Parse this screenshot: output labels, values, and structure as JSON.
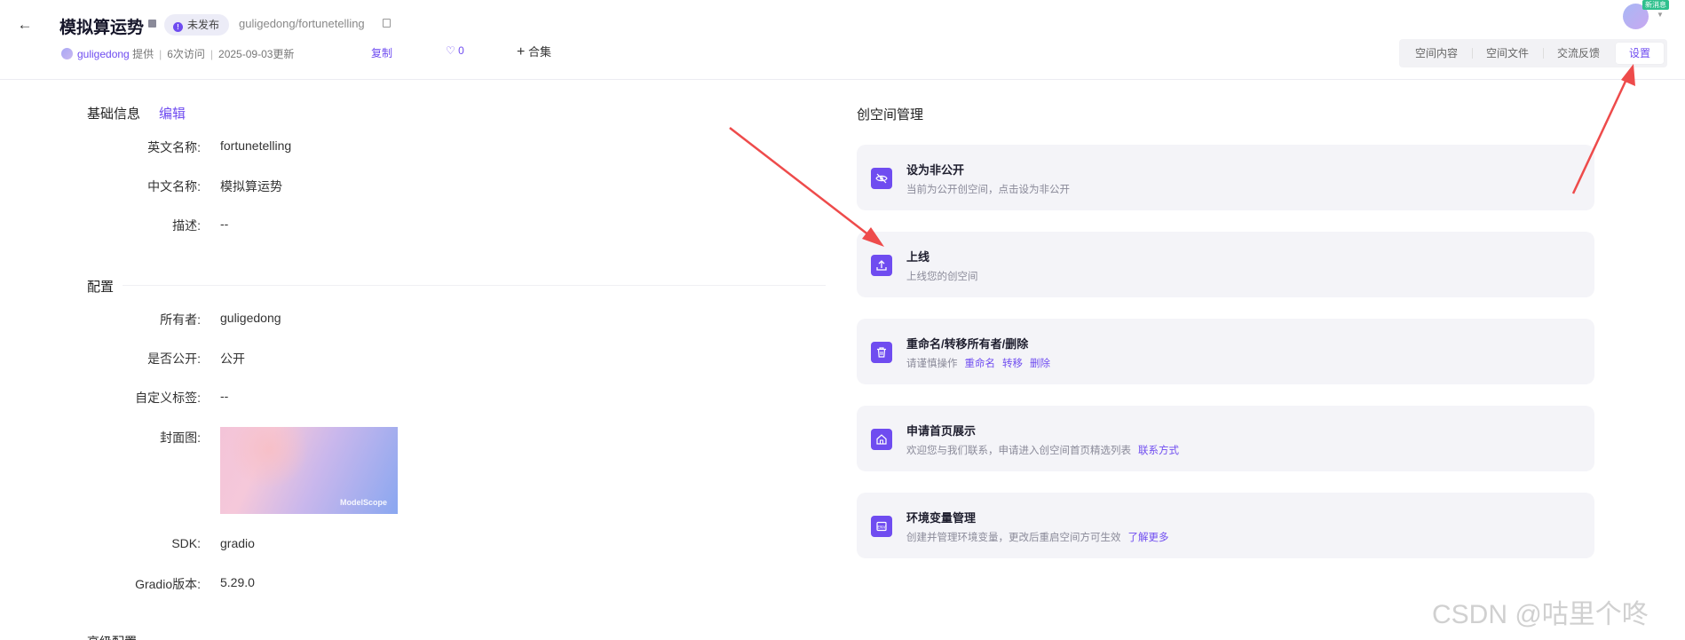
{
  "header": {
    "title": "模拟算运势",
    "status_badge": "未发布",
    "path": "guligedong/fortunetelling",
    "owner": "guligedong",
    "provided": "提供",
    "visits": "6次访问",
    "updated": "2025-09-03更新",
    "copy_label": "复制",
    "likes": "0",
    "collect_label": "合集",
    "tabs": [
      "空间内容",
      "空间文件",
      "交流反馈",
      "设置"
    ],
    "active_tab": "设置",
    "new_message_badge": "新消息"
  },
  "basic": {
    "title": "基础信息",
    "edit_label": "编辑",
    "fields": [
      {
        "label": "英文名称:",
        "value": "fortunetelling"
      },
      {
        "label": "中文名称:",
        "value": "模拟算运势"
      },
      {
        "label": "描述:",
        "value": "--"
      }
    ]
  },
  "config": {
    "title": "配置",
    "fields": [
      {
        "label": "所有者:",
        "value": "guligedong"
      },
      {
        "label": "是否公开:",
        "value": "公开"
      },
      {
        "label": "自定义标签:",
        "value": "--"
      },
      {
        "label": "封面图:",
        "value": ""
      },
      {
        "label": "SDK:",
        "value": "gradio"
      },
      {
        "label": "Gradio版本:",
        "value": "5.29.0"
      }
    ],
    "cover_watermark": "ModelScope"
  },
  "next_section_partial": "高级配置",
  "management": {
    "title": "创空间管理",
    "cards": [
      {
        "title": "设为非公开",
        "desc": "当前为公开创空间，点击设为非公开",
        "icon": "eye-off-icon",
        "links": []
      },
      {
        "title": "上线",
        "desc": "上线您的创空间",
        "icon": "upload-icon",
        "links": []
      },
      {
        "title": "重命名/转移所有者/删除",
        "desc": "请谨慎操作",
        "icon": "trash-icon",
        "links": [
          "重命名",
          "转移",
          "删除"
        ]
      },
      {
        "title": "申请首页展示",
        "desc": "欢迎您与我们联系，申请进入创空间首页精选列表",
        "icon": "home-icon",
        "links": [
          "联系方式"
        ]
      },
      {
        "title": "环境变量管理",
        "desc": "创建并管理环境变量，更改后重启空间方可生效",
        "icon": "env-icon",
        "links": [
          "了解更多"
        ]
      }
    ]
  },
  "watermark": "CSDN @咕里个咚",
  "colors": {
    "accent": "#6f4cf0",
    "annotation_arrow": "#ee4b4b",
    "card_bg": "#f4f4f8"
  }
}
